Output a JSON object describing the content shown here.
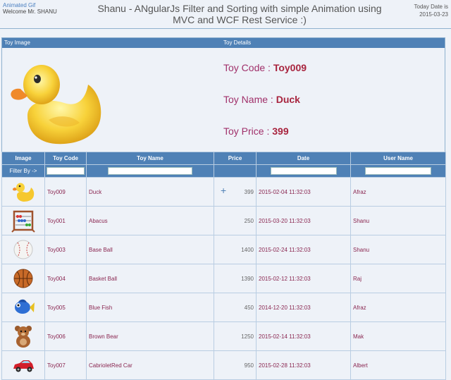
{
  "header": {
    "animated_gif": "Animated Gif",
    "welcome": "Welcome Mr. SHANU",
    "title": "Shanu - ANgularJs Filter and Sorting with simple Animation using MVC and WCF Rest Service :)",
    "date_label": "Today Date is",
    "date_value": "2015-03-23"
  },
  "detail": {
    "image_header": "Toy Image",
    "details_header": "Toy Details",
    "code_label": "Toy Code : ",
    "code_value": "Toy009",
    "name_label": "Toy Name : ",
    "name_value": "Duck",
    "price_label": "Toy Price : ",
    "price_value": "399",
    "image_icon": "duck-icon"
  },
  "grid": {
    "columns": [
      "Image",
      "Toy Code",
      "Toy Name",
      "Price",
      "Date",
      "User Name"
    ],
    "filter_label": "Filter By ->",
    "rows": [
      {
        "icon": "duck-icon",
        "code": "Toy009",
        "name": "Duck",
        "price": "399",
        "date": "2015-02-04 11:32:03",
        "user": "Afraz"
      },
      {
        "icon": "abacus-icon",
        "code": "Toy001",
        "name": "Abacus",
        "price": "250",
        "date": "2015-03-20 11:32:03",
        "user": "Shanu"
      },
      {
        "icon": "baseball-icon",
        "code": "Toy003",
        "name": "Base Ball",
        "price": "1400",
        "date": "2015-02-24 11:32:03",
        "user": "Shanu"
      },
      {
        "icon": "basketball-icon",
        "code": "Toy004",
        "name": "Basket Ball",
        "price": "1390",
        "date": "2015-02-12 11:32:03",
        "user": "Raj"
      },
      {
        "icon": "bluefish-icon",
        "code": "Toy005",
        "name": "Blue Fish",
        "price": "450",
        "date": "2014-12-20 11:32:03",
        "user": "Afraz"
      },
      {
        "icon": "bear-icon",
        "code": "Toy006",
        "name": "Brown Bear",
        "price": "1250",
        "date": "2015-02-14 11:32:03",
        "user": "Mak"
      },
      {
        "icon": "car-icon",
        "code": "Toy007",
        "name": "CabrioletRed Car",
        "price": "950",
        "date": "2015-02-28 11:32:03",
        "user": "Albert"
      }
    ]
  }
}
